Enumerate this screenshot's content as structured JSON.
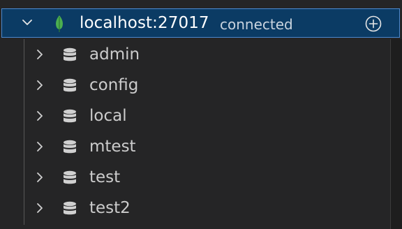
{
  "connection": {
    "host": "localhost:27017",
    "status": "connected",
    "icons": {
      "expand": "chevron-down-icon",
      "leaf": "mongodb-leaf-icon",
      "add": "add-circle-icon"
    },
    "colors": {
      "row_background": "#0b3b64",
      "row_border": "#4c89cf",
      "leaf_green": "#4caf50"
    }
  },
  "databases": [
    {
      "name": "admin"
    },
    {
      "name": "config"
    },
    {
      "name": "local"
    },
    {
      "name": "mtest"
    },
    {
      "name": "test"
    },
    {
      "name": "test2"
    }
  ],
  "icons": {
    "collapsed": "chevron-right-icon",
    "database": "database-icon"
  }
}
